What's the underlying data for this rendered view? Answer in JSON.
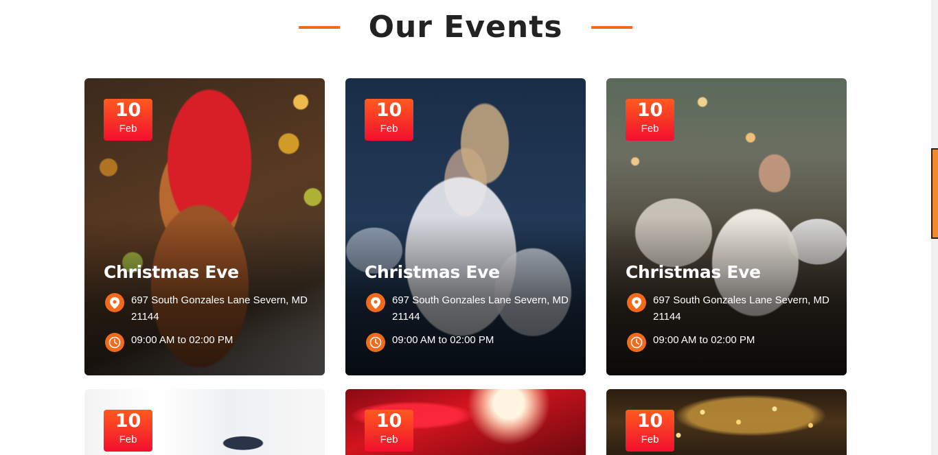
{
  "section": {
    "title": "Our Events"
  },
  "colors": {
    "accent": "#f26b1d",
    "badge_top": "#ff5a1f",
    "badge_bottom": "#f20f2e",
    "heading": "#222222"
  },
  "icons": {
    "location": "map-pin-icon",
    "time": "clock-icon"
  },
  "events": [
    {
      "day": "10",
      "month": "Feb",
      "title": "Christmas Eve",
      "location": "697 South Gonzales Lane Severn, MD 21144",
      "time": "09:00 AM to 02:00 PM"
    },
    {
      "day": "10",
      "month": "Feb",
      "title": "Christmas Eve",
      "location": "697 South Gonzales Lane Severn, MD 21144",
      "time": "09:00 AM to 02:00 PM"
    },
    {
      "day": "10",
      "month": "Feb",
      "title": "Christmas Eve",
      "location": "697 South Gonzales Lane Severn, MD 21144",
      "time": "09:00 AM to 02:00 PM"
    },
    {
      "day": "10",
      "month": "Feb"
    },
    {
      "day": "10",
      "month": "Feb"
    },
    {
      "day": "10",
      "month": "Feb"
    }
  ]
}
